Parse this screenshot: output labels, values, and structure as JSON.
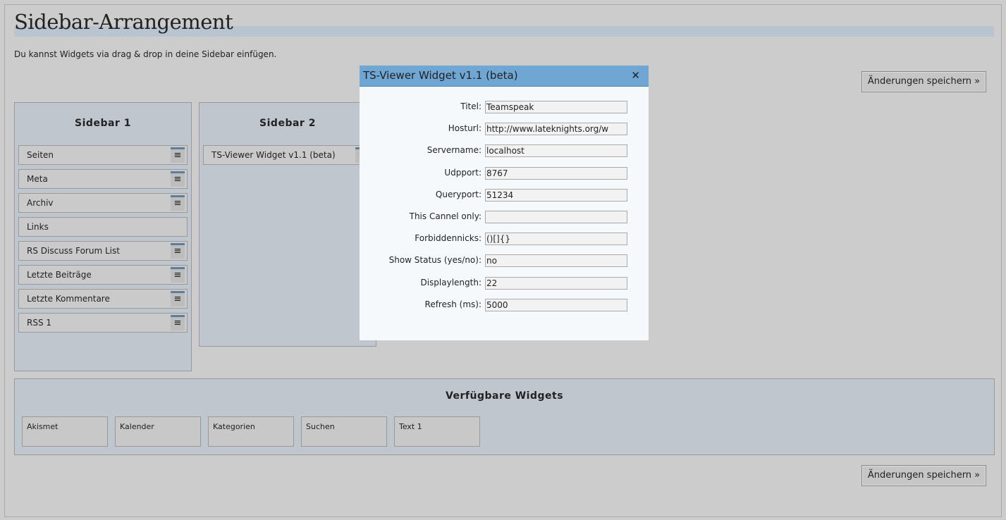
{
  "page": {
    "title": "Sidebar-Arrangement",
    "intro": "Du kannst Widgets via drag & drop in deine Sidebar einfügen.",
    "save_label": "Änderungen speichern »"
  },
  "sidebar1": {
    "title": "Sidebar 1",
    "items": [
      {
        "label": "Seiten",
        "handle": true
      },
      {
        "label": "Meta",
        "handle": true
      },
      {
        "label": "Archiv",
        "handle": true
      },
      {
        "label": "Links",
        "handle": false
      },
      {
        "label": "RS Discuss Forum List",
        "handle": true
      },
      {
        "label": "Letzte Beiträge",
        "handle": true
      },
      {
        "label": "Letzte Kommentare",
        "handle": true
      },
      {
        "label": "RSS 1",
        "handle": true
      }
    ]
  },
  "sidebar2": {
    "title": "Sidebar 2",
    "items": [
      {
        "label": "TS-Viewer Widget v1.1 (beta)"
      }
    ]
  },
  "available": {
    "title": "Verfügbare Widgets",
    "items": [
      "Akismet",
      "Kalender",
      "Kategorien",
      "Suchen",
      "Text 1"
    ]
  },
  "dialog": {
    "title": "TS-Viewer Widget v1.1 (beta)",
    "close": "✕",
    "fields": [
      {
        "label": "Titel:",
        "value": "Teamspeak"
      },
      {
        "label": "Hosturl:",
        "value": "http://www.lateknights.org/w"
      },
      {
        "label": "Servername:",
        "value": "localhost"
      },
      {
        "label": "Udpport:",
        "value": "8767"
      },
      {
        "label": "Queryport:",
        "value": "51234"
      },
      {
        "label": "This Cannel only:",
        "value": ""
      },
      {
        "label": "Forbiddennicks:",
        "value": "()[]{}"
      },
      {
        "label": "Show Status (yes/no):",
        "value": "no"
      },
      {
        "label": "Displaylength:",
        "value": "22"
      },
      {
        "label": "Refresh (ms):",
        "value": "5000"
      }
    ]
  },
  "handle_glyph": "≡"
}
